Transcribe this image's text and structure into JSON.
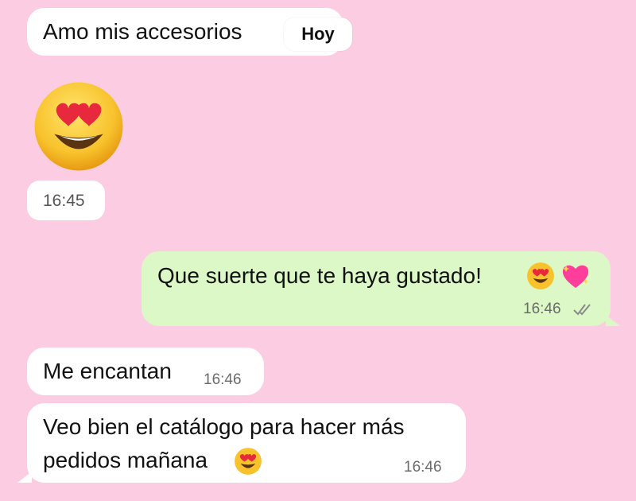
{
  "colors": {
    "background": "#fccde2",
    "incoming_bubble": "#ffffff",
    "outgoing_bubble": "#dcf8c6",
    "tick_color": "#8a8a8a"
  },
  "date_separator": "Hoy",
  "messages": [
    {
      "direction": "incoming",
      "text": "Amo mis accesorios",
      "time": ""
    },
    {
      "direction": "incoming",
      "text": "",
      "emoji": "heart-eyes-emoji",
      "time": "16:45"
    },
    {
      "direction": "outgoing",
      "text": "Que suerte que te haya gustado!",
      "emojis": [
        "heart-eyes-emoji",
        "sparkling-heart-emoji"
      ],
      "time": "16:46",
      "status": "read-double-check-icon"
    },
    {
      "direction": "incoming",
      "text": "Me encantan",
      "time": "16:46"
    },
    {
      "direction": "incoming",
      "text_lines": [
        "Veo bien el catálogo para hacer más",
        "pedidos mañana"
      ],
      "emoji": "heart-eyes-emoji",
      "time": "16:46"
    }
  ]
}
